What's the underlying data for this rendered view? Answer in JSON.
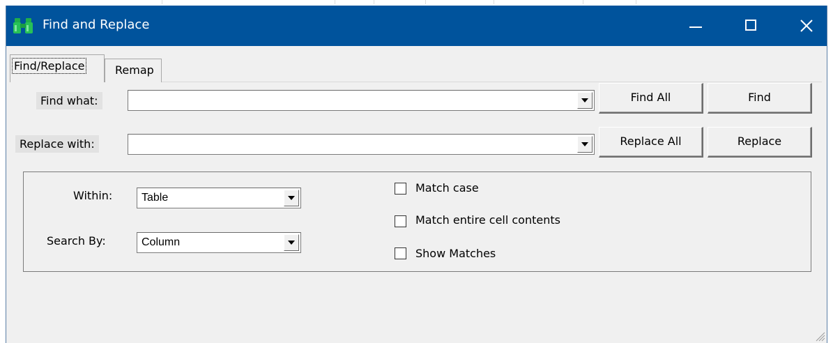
{
  "window": {
    "title": "Find and Replace",
    "accent_color": "#00539c",
    "icon": "binoculars-icon"
  },
  "tabs": [
    {
      "label": "Find/Replace",
      "active": true
    },
    {
      "label": "Remap",
      "active": false
    }
  ],
  "find": {
    "label": "Find what:",
    "value": "",
    "find_all_label": "Find All",
    "find_label": "Find"
  },
  "replace": {
    "label": "Replace with:",
    "value": "",
    "replace_all_label": "Replace All",
    "replace_label": "Replace"
  },
  "options": {
    "within_label": "Within:",
    "within_value": "Table",
    "search_by_label": "Search By:",
    "search_by_value": "Column",
    "match_case_label": "Match case",
    "match_case_checked": false,
    "match_entire_label": "Match entire cell contents",
    "match_entire_checked": false,
    "show_matches_label": "Show Matches",
    "show_matches_checked": false
  }
}
